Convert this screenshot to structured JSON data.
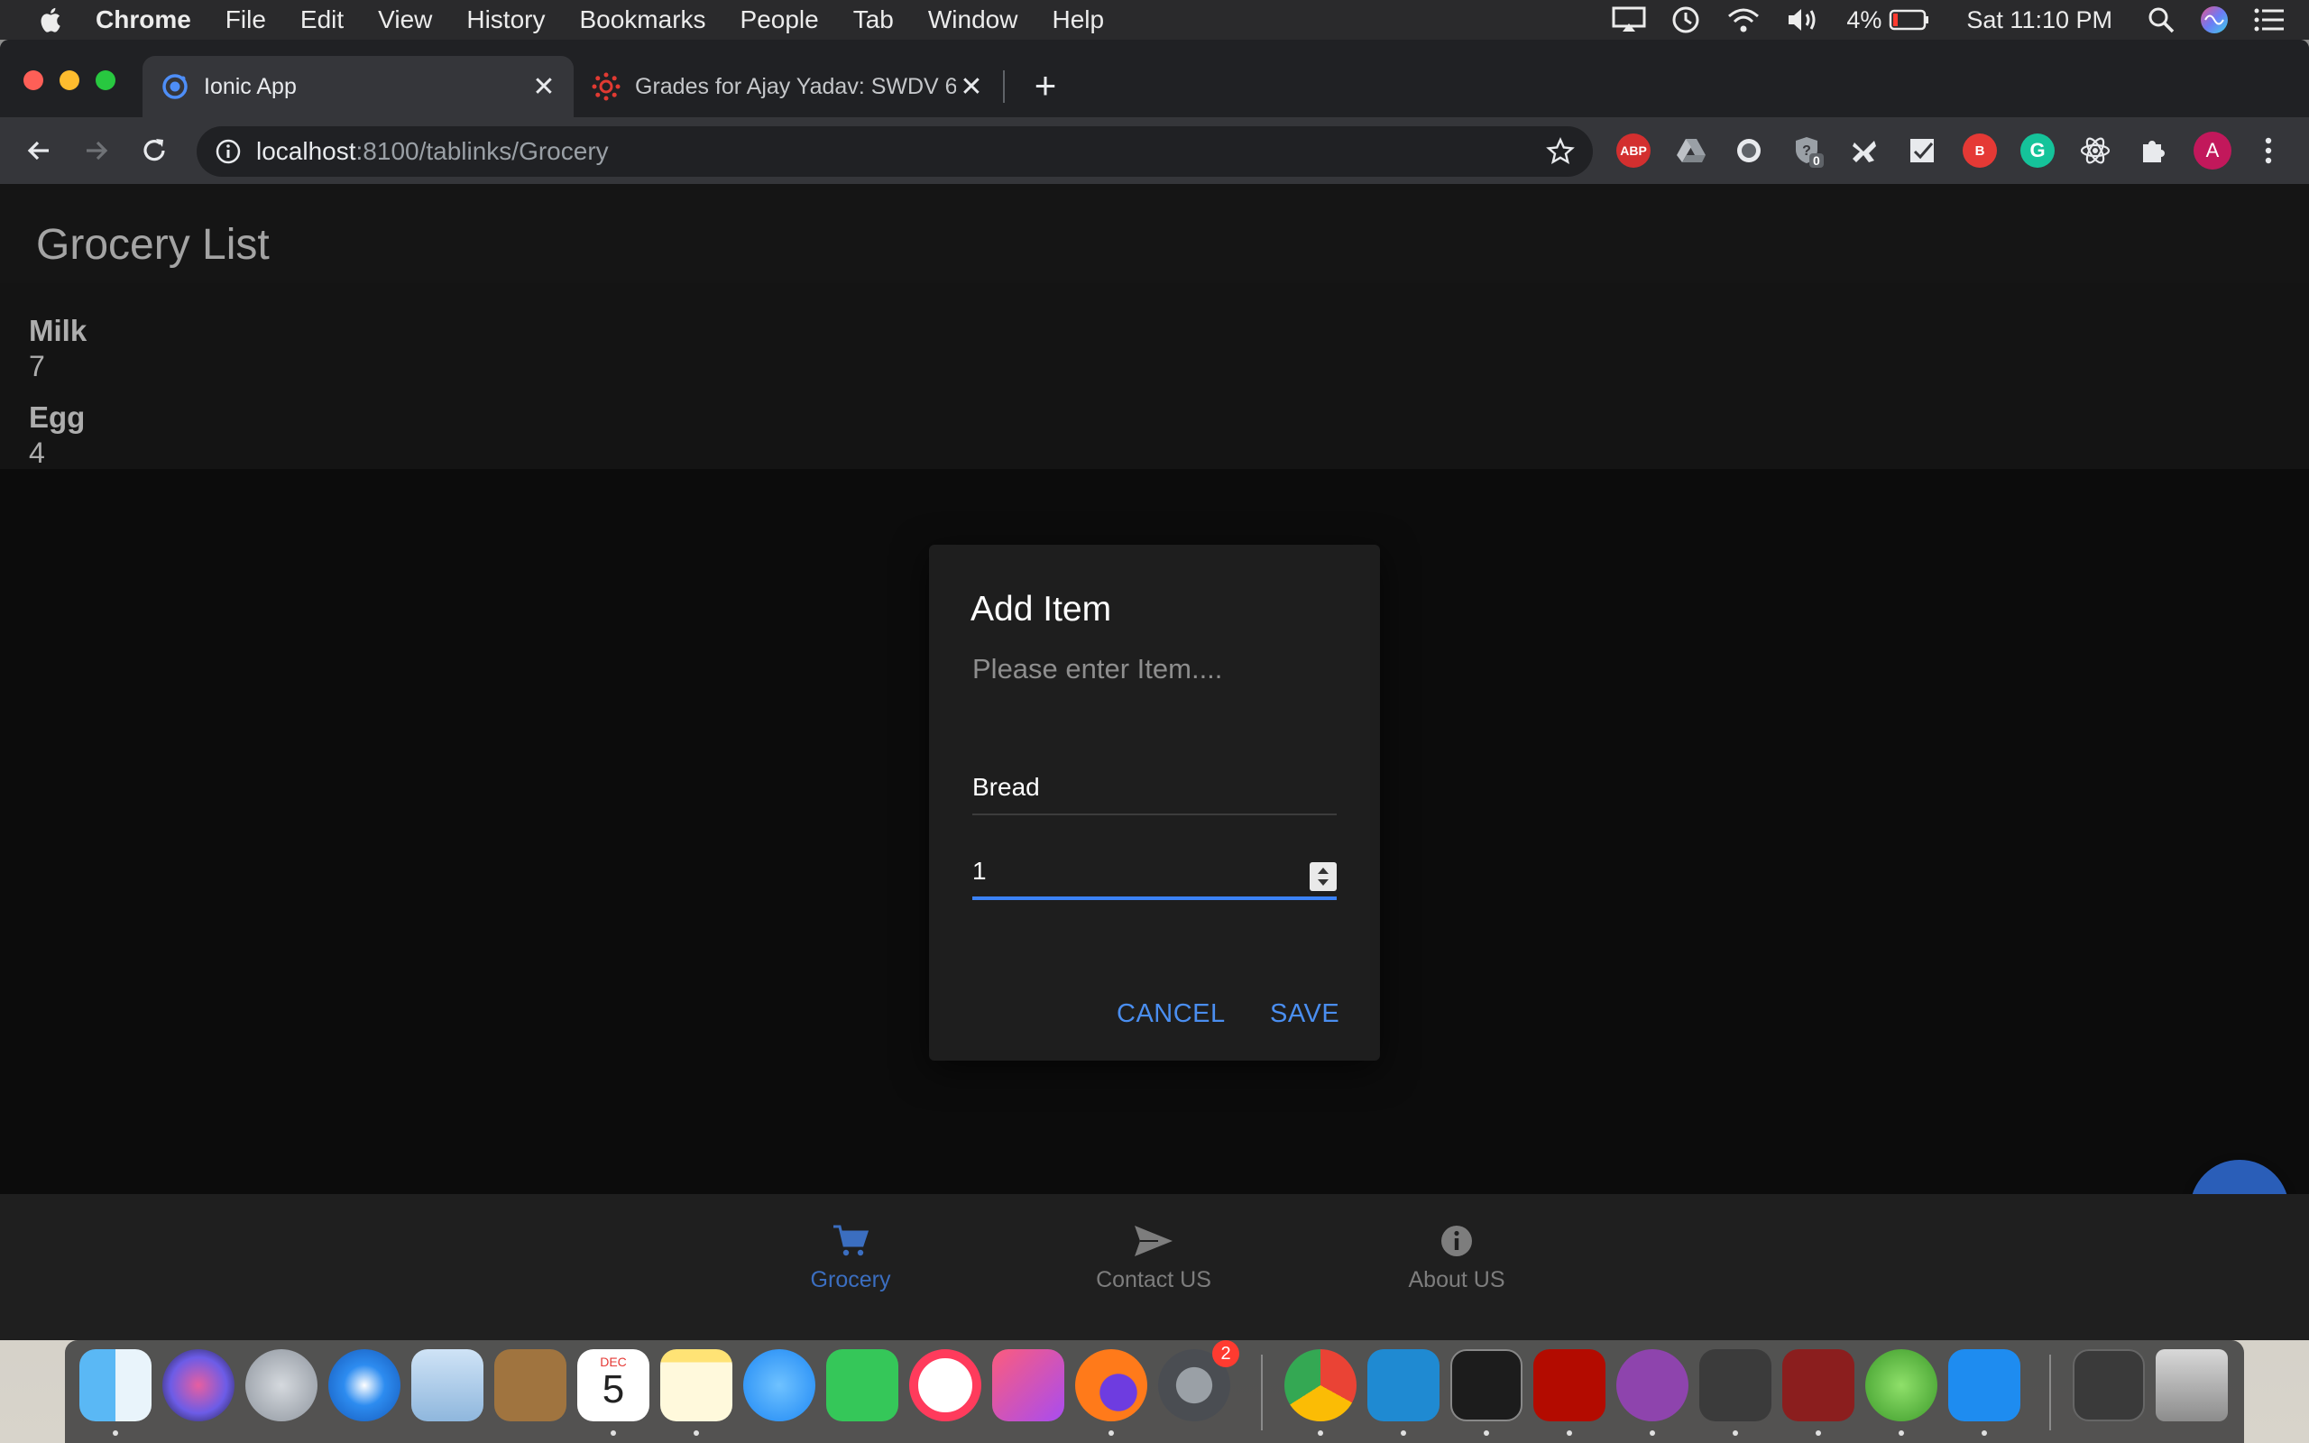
{
  "menubar": {
    "app_name": "Chrome",
    "items": [
      "File",
      "Edit",
      "View",
      "History",
      "Bookmarks",
      "People",
      "Tab",
      "Window",
      "Help"
    ],
    "battery": "4%",
    "clock": "Sat 11:10 PM"
  },
  "browser": {
    "tabs": [
      {
        "title": "Ionic App",
        "active": true,
        "icon": "ionic-logo-icon"
      },
      {
        "title": "Grades for Ajay Yadav: SWDV 6",
        "active": false,
        "icon": "canvas-logo-icon"
      }
    ],
    "url_host": "localhost",
    "url_rest": ":8100/tablinks/Grocery",
    "extensions": [
      "ABP",
      "drive",
      "circle",
      "0",
      "puzzle-pin",
      "checkbox",
      "B",
      "G",
      "react",
      "puzzle",
      "A"
    ],
    "profile_initial": "A"
  },
  "app": {
    "title": "Grocery List",
    "items": [
      {
        "name": "Milk",
        "quantity": "7"
      },
      {
        "name": "Egg",
        "quantity": "4"
      }
    ],
    "tabs": [
      {
        "label": "Grocery",
        "icon": "cart-icon",
        "selected": true
      },
      {
        "label": "Contact US",
        "icon": "send-icon",
        "selected": false
      },
      {
        "label": "About US",
        "icon": "info-icon",
        "selected": false
      }
    ],
    "fab_icon": "plus-icon"
  },
  "alert": {
    "title": "Add Item",
    "message": "Please enter Item....",
    "name_value": "Bread",
    "quantity_value": "1",
    "cancel_label": "CANCEL",
    "save_label": "SAVE"
  },
  "colors": {
    "accent": "#3b82f6",
    "tab_selected": "#3b6ec0",
    "fab": "#2a5eb8",
    "page_bg": "#121212"
  },
  "dock": {
    "calendar_month": "DEC",
    "calendar_day": "5",
    "prefs_badge": "2"
  }
}
